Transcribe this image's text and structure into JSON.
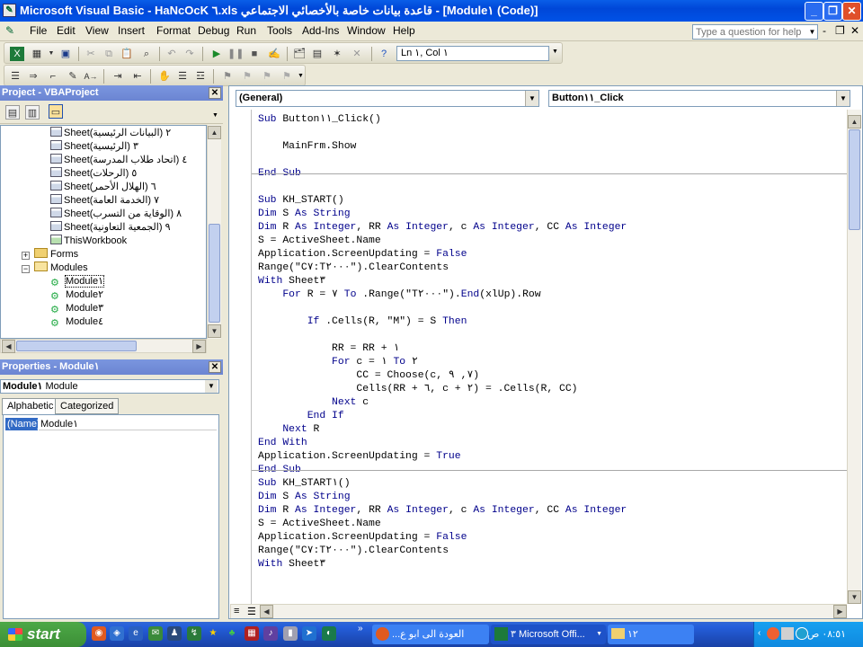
{
  "window": {
    "title": "Microsoft Visual Basic - HaNcOcK ٦.xls قاعدة بيانات خاصة بالأخصائي الاجتماعي - [Module١ (Code)]"
  },
  "menu": [
    "File",
    "Edit",
    "View",
    "Insert",
    "Format",
    "Debug",
    "Run",
    "Tools",
    "Add-Ins",
    "Window",
    "Help"
  ],
  "help": {
    "placeholder": "Type a question for help"
  },
  "toolbar": {
    "position": "Ln ١, Col ١"
  },
  "project": {
    "title": "Project - VBAProject",
    "items": [
      {
        "label": "Sheet٢ (البيانات الرئيسية)",
        "type": "sheet"
      },
      {
        "label": "Sheet٣ (الرئيسية)",
        "type": "sheet"
      },
      {
        "label": "Sheet٤ (اتحاد طلاب المدرسة)",
        "type": "sheet"
      },
      {
        "label": "Sheet٥ (الرحلات)",
        "type": "sheet"
      },
      {
        "label": "Sheet٦ (الهلال الأحمر)",
        "type": "sheet"
      },
      {
        "label": "Sheet٧ (الخدمة العامة)",
        "type": "sheet"
      },
      {
        "label": "Sheet٨ (الوقاية من التسرب)",
        "type": "sheet"
      },
      {
        "label": "Sheet٩ (الجمعية التعاونية)",
        "type": "sheet"
      },
      {
        "label": "ThisWorkbook",
        "type": "workbook"
      },
      {
        "label": "Forms",
        "type": "folder"
      },
      {
        "label": "Modules",
        "type": "folder-open"
      },
      {
        "label": "Module١",
        "type": "module"
      },
      {
        "label": "Module٢",
        "type": "module"
      },
      {
        "label": "Module٣",
        "type": "module"
      },
      {
        "label": "Module٤",
        "type": "module"
      }
    ]
  },
  "properties": {
    "title": "Properties - Module١",
    "object_name": "Module١",
    "object_type": "Module",
    "tabs": [
      "Alphabetic",
      "Categorized"
    ],
    "rows": [
      {
        "name": "(Name)",
        "value": "Module١"
      }
    ]
  },
  "code": {
    "object_combo": "(General)",
    "proc_combo": "Button١١_Click",
    "lines": [
      "Sub Button١١_Click()",
      "",
      "    MainFrm.Show",
      "",
      "End Sub",
      "---",
      "",
      "Sub KH_START()",
      "Dim S As String",
      "Dim R As Integer, RR As Integer, c As Integer, CC As Integer",
      "S = ActiveSheet.Name",
      "Application.ScreenUpdating = False",
      "Range(\"C٧:T٢٠٠٠\").ClearContents",
      "With Sheet٣",
      "    For R = ٧ To .Range(\"T٢٠٠٠\").End(xlUp).Row",
      "",
      "        If .Cells(R, \"M\") = S Then",
      "",
      "            RR = RR + ١",
      "            For c = ١ To ٢",
      "                CC = Choose(c, ٧, ٩)",
      "                Cells(RR + ٦, c + ٢) = .Cells(R, CC)",
      "            Next c",
      "        End If",
      "    Next R",
      "End With",
      "Application.ScreenUpdating = True",
      "End Sub",
      "---",
      "Sub KH_START١()",
      "Dim S As String",
      "Dim R As Integer, RR As Integer, c As Integer, CC As Integer",
      "S = ActiveSheet.Name",
      "Application.ScreenUpdating = False",
      "Range(\"C٧:T٢٠٠٠\").ClearContents",
      "With Sheet٣"
    ]
  },
  "taskbar": {
    "start": "start",
    "tasks": [
      "العودة الى ابو ع...",
      "٣ Microsoft Offi...",
      "١٢"
    ],
    "clock": "٠٨:٥١ ص"
  }
}
